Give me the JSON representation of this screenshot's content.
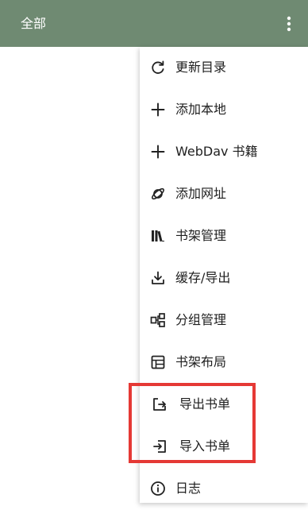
{
  "appbar": {
    "title": "全部",
    "more_icon": "more-vertical-icon",
    "background": "#6f8a72"
  },
  "menu": {
    "items": [
      {
        "label": "更新目录",
        "icon": "refresh-icon"
      },
      {
        "label": "添加本地",
        "icon": "plus-icon"
      },
      {
        "label": "WebDav 书籍",
        "icon": "plus-icon"
      },
      {
        "label": "添加网址",
        "icon": "planet-icon"
      },
      {
        "label": "书架管理",
        "icon": "books-icon"
      },
      {
        "label": "缓存/导出",
        "icon": "download-icon"
      },
      {
        "label": "分组管理",
        "icon": "group-icon"
      },
      {
        "label": "书架布局",
        "icon": "layout-icon"
      },
      {
        "label": "导出书单",
        "icon": "export-icon"
      },
      {
        "label": "导入书单",
        "icon": "import-icon"
      },
      {
        "label": "日志",
        "icon": "info-icon"
      }
    ]
  },
  "highlight": {
    "color": "#e53935"
  }
}
